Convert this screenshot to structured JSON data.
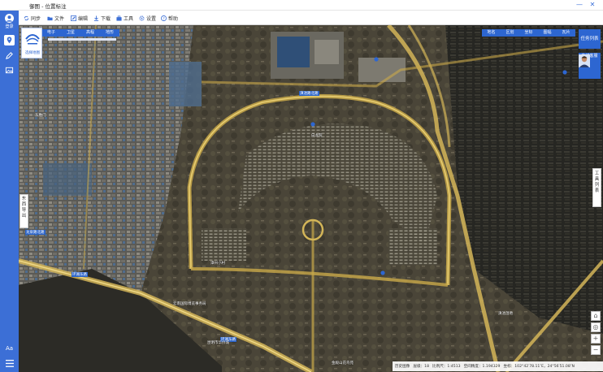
{
  "window": {
    "title": "御图 - 位置标注",
    "minimize": "—",
    "close": "✕"
  },
  "toolbar": [
    {
      "label": "同步",
      "icon": "sync-icon"
    },
    {
      "label": "文件",
      "icon": "folder-icon"
    },
    {
      "label": "编辑",
      "icon": "edit-icon"
    },
    {
      "label": "下载",
      "icon": "download-icon"
    },
    {
      "label": "工具",
      "icon": "toolbox-icon"
    },
    {
      "label": "设置",
      "icon": "gear-icon"
    },
    {
      "label": "帮助",
      "icon": "help-icon"
    }
  ],
  "sidebar": {
    "login_label": "登录",
    "logo_caption": "选择地图"
  },
  "map_type_tabs": [
    "电子",
    "卫星",
    "高程",
    "地形"
  ],
  "overlay_tabs": [
    "地名",
    "区划",
    "坐标",
    "图幅",
    "瓦片"
  ],
  "right_buttons": {
    "task_list": "任务列表",
    "online_service": "在线客服"
  },
  "side_tabs": {
    "left": "东\n西\n导\n出",
    "right": "工\n具\n列\n表"
  },
  "zoom_controls": {
    "home": "⌂",
    "locate": "◎",
    "zoom_in": "+",
    "zoom_out": "−"
  },
  "poi_labels": {
    "road_top": "滇池路北路",
    "road_left": "龙泉路北路",
    "road_bottom": "环湖东路",
    "road_bottom2": "环湖东路",
    "poi_1": "东胜门",
    "poi_2": "漳州小村",
    "poi_3": "云南国际博览事务局",
    "poi_4": "白龙院",
    "poi_5": "滇池湿地",
    "poi_6": "金殿山花鸟苑",
    "poi_7": "昆明市华侨城"
  },
  "status": {
    "history": "历史图像",
    "level": "层级：18",
    "scale": "比例尺：1:4513",
    "spatial": "空间精度：1.194329",
    "coords": "坐标：102°42′78.11″E，24°56′51.08″N"
  }
}
